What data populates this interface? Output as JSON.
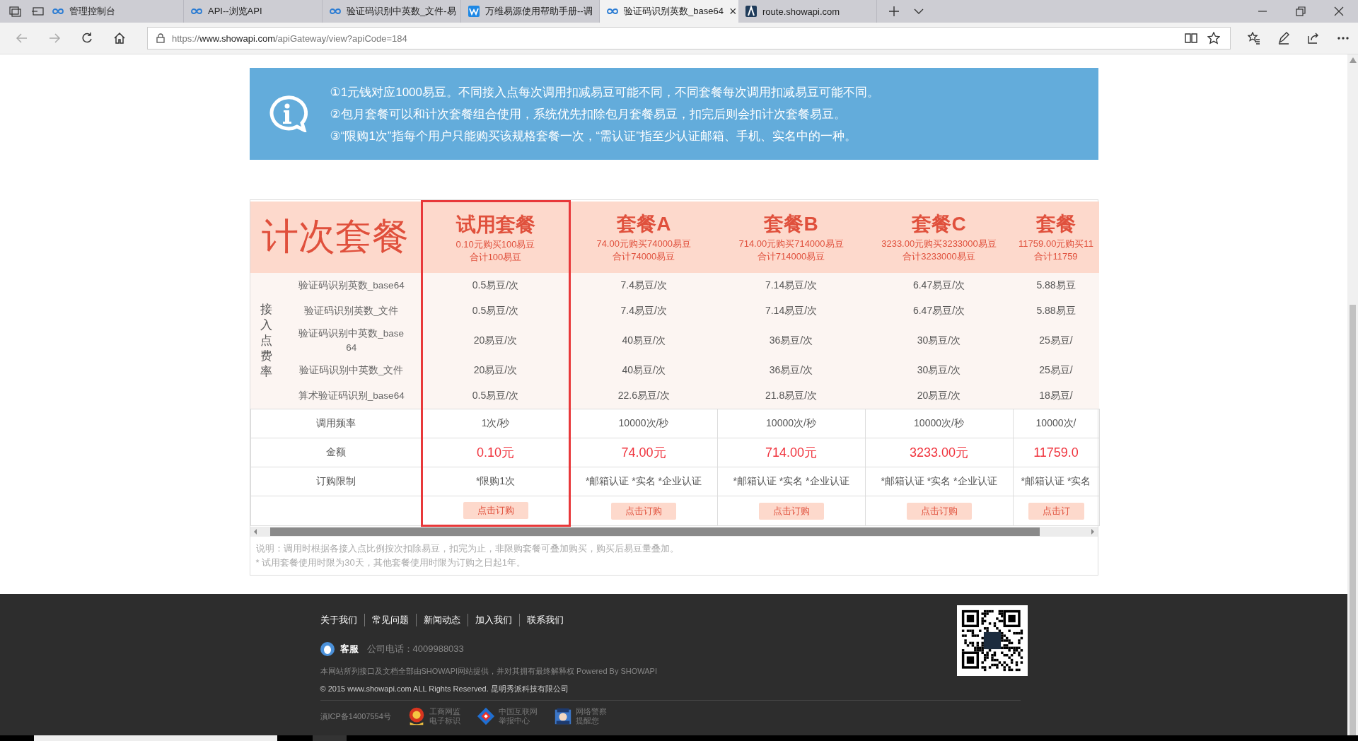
{
  "browser": {
    "tabs": [
      {
        "title": "管理控制台",
        "kind": "loop",
        "selected": false
      },
      {
        "title": "API--浏览API",
        "kind": "loop",
        "selected": false
      },
      {
        "title": "验证码识别中英数_文件-易",
        "kind": "loop",
        "selected": false
      },
      {
        "title": "万维易源使用帮助手册--调",
        "kind": "w",
        "selected": false
      },
      {
        "title": "验证码识别英数_base64",
        "kind": "loop",
        "selected": true,
        "close": "×"
      },
      {
        "title": "route.showapi.com",
        "kind": "a",
        "selected": false
      }
    ],
    "address": {
      "scheme": "https://",
      "domain": "www.showapi.com",
      "path": "/apiGateway/view?apiCode=184"
    }
  },
  "info": {
    "lines": [
      "①1元钱对应1000易豆。不同接入点每次调用扣减易豆可能不同，不同套餐每次调用扣减易豆可能不同。",
      "②包月套餐可以和计次套餐组合使用，系统优先扣除包月套餐易豆，扣完后则会扣计次套餐易豆。",
      "③“限购1次”指每个用户只能购买该规格套餐一次，“需认证”指至少认证邮箱、手机、实名中的一种。"
    ]
  },
  "pricing": {
    "title": "计次套餐",
    "rate_label": "接入点费率",
    "plans": [
      {
        "name": "试用套餐",
        "desc": "0.10元购买100易豆",
        "total": "合计100易豆",
        "selected": true
      },
      {
        "name": "套餐A",
        "desc": "74.00元购买74000易豆",
        "total": "合计74000易豆",
        "selected": false
      },
      {
        "name": "套餐B",
        "desc": "714.00元购买714000易豆",
        "total": "合计714000易豆",
        "selected": false
      },
      {
        "name": "套餐C",
        "desc": "3233.00元购买3233000易豆",
        "total": "合计3233000易豆",
        "selected": false
      },
      {
        "name": "套餐",
        "desc": "11759.00元购买11",
        "total": "合计11759",
        "selected": false
      }
    ],
    "rate_rows": [
      {
        "endpoint": "验证码识别英数_base64",
        "values": [
          "0.5易豆/次",
          "7.4易豆/次",
          "7.14易豆/次",
          "6.47易豆/次",
          "5.88易豆"
        ]
      },
      {
        "endpoint": "验证码识别英数_文件",
        "values": [
          "0.5易豆/次",
          "7.4易豆/次",
          "7.14易豆/次",
          "6.47易豆/次",
          "5.88易豆"
        ]
      },
      {
        "endpoint": "验证码识别中英数_base64",
        "values": [
          "20易豆/次",
          "40易豆/次",
          "36易豆/次",
          "30易豆/次",
          "25易豆/"
        ]
      },
      {
        "endpoint": "验证码识别中英数_文件",
        "values": [
          "20易豆/次",
          "40易豆/次",
          "36易豆/次",
          "30易豆/次",
          "25易豆/"
        ]
      },
      {
        "endpoint": "算术验证码识别_base64",
        "values": [
          "0.5易豆/次",
          "22.6易豆/次",
          "21.8易豆/次",
          "20易豆/次",
          "18易豆/"
        ]
      }
    ],
    "rows": [
      {
        "label": "调用频率",
        "kind": "plain",
        "values": [
          "1次/秒",
          "10000次/秒",
          "10000次/秒",
          "10000次/秒",
          "10000次/"
        ]
      },
      {
        "label": "金额",
        "kind": "price",
        "values": [
          "0.10元",
          "74.00元",
          "714.00元",
          "3233.00元",
          "11759.0"
        ]
      },
      {
        "label": "订购限制",
        "kind": "plain",
        "values": [
          "*限购1次",
          "*邮箱认证 *实名 *企业认证",
          "*邮箱认证 *实名 *企业认证",
          "*邮箱认证 *实名 *企业认证",
          "*邮箱认证 *实名"
        ]
      }
    ],
    "buttons": [
      "点击订购",
      "点击订购",
      "点击订购",
      "点击订购",
      "点击订"
    ],
    "notes": [
      "说明：调用时根据各接入点比例按次扣除易豆，扣完为止，非限购套餐可叠加购买，购买后易豆量叠加。",
      "* 试用套餐使用时限为30天，其他套餐使用时限为订购之日起1年。"
    ]
  },
  "footer": {
    "links": [
      "关于我们",
      "常见问题",
      "新闻动态",
      "加入我们",
      "联系我们"
    ],
    "service": "客服",
    "phone": "公司电话：4009988033",
    "disclaimer": "本网站所列接口及文档全部由SHOWAPI网站提供，并对其拥有最终解释权 Powered By SHOWAPI",
    "copyright": "© 2015 www.showapi.com ALL Rights Reserved. 昆明秀派科技有限公司",
    "icp": "滇ICP备14007554号",
    "badges": [
      {
        "kind": "emblem",
        "lines": [
          "工商网监",
          "电子标识"
        ]
      },
      {
        "kind": "report",
        "lines": [
          "中国互联网",
          "举报中心"
        ]
      },
      {
        "kind": "police",
        "lines": [
          "网络警察",
          "提醒您"
        ]
      }
    ]
  }
}
